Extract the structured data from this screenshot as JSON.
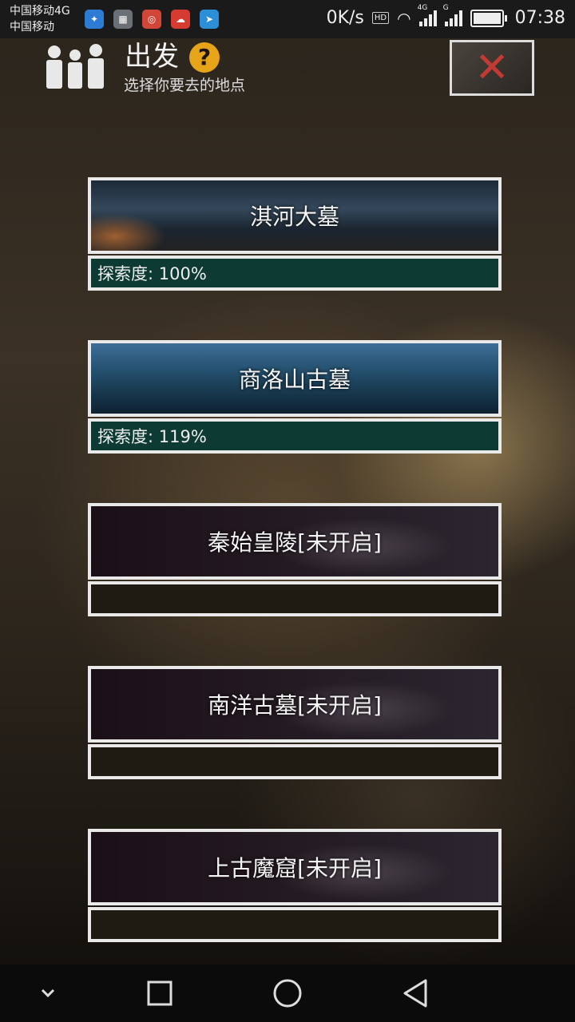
{
  "status_bar": {
    "carrier_1": "中国移动4G",
    "carrier_2": "中国移动",
    "net_speed": "0K/s",
    "hd_badge": "HD",
    "signal_1_tag": "4G",
    "signal_2_tag": "G",
    "time": "07:38"
  },
  "header": {
    "title": "出发",
    "help_symbol": "?",
    "subtitle": "选择你要去的地点"
  },
  "locations": [
    {
      "name": "淇河大墓",
      "progress_text": "探索度: 100%",
      "progress_percent": 100,
      "unlocked": true
    },
    {
      "name": "商洛山古墓",
      "progress_text": "探索度: 119%",
      "progress_percent": 119,
      "unlocked": true
    },
    {
      "name": "秦始皇陵[未开启]",
      "progress_text": "",
      "unlocked": false
    },
    {
      "name": "南洋古墓[未开启]",
      "progress_text": "",
      "unlocked": false
    },
    {
      "name": "上古魔窟[未开启]",
      "progress_text": "",
      "unlocked": false
    }
  ],
  "colors": {
    "unlocked_bar": "#0d3a33",
    "locked_bar": "#1f1b12",
    "close_x": "#c23a34",
    "help_badge": "#e6a419"
  }
}
